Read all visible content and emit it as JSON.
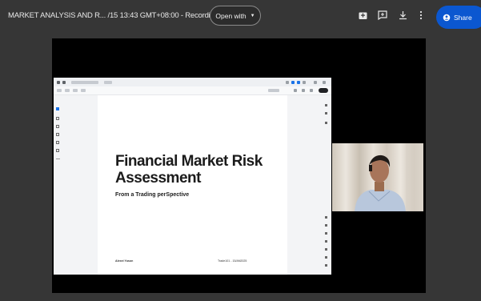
{
  "header": {
    "file_title": "MARKET ANALYSIS AND R... /15 13:43 GMT+08:00 - Recording",
    "open_with_label": "Open with",
    "share_label": "Share"
  },
  "icons": {
    "add_to_drive": "add-to-drive-icon",
    "comment": "add-comment-icon",
    "download": "download-icon",
    "more": "more-vert-icon",
    "share_lock": "share-person-icon"
  },
  "slide": {
    "title": "Financial Market Risk Assessment",
    "subtitle": "From a Trading perSpective",
    "author": "Alexei Yuson",
    "footer_right": "Trade101 - 15/AN2025"
  },
  "colors": {
    "background": "#363636",
    "share_button": "#0b57d0",
    "video_black": "#000000"
  }
}
